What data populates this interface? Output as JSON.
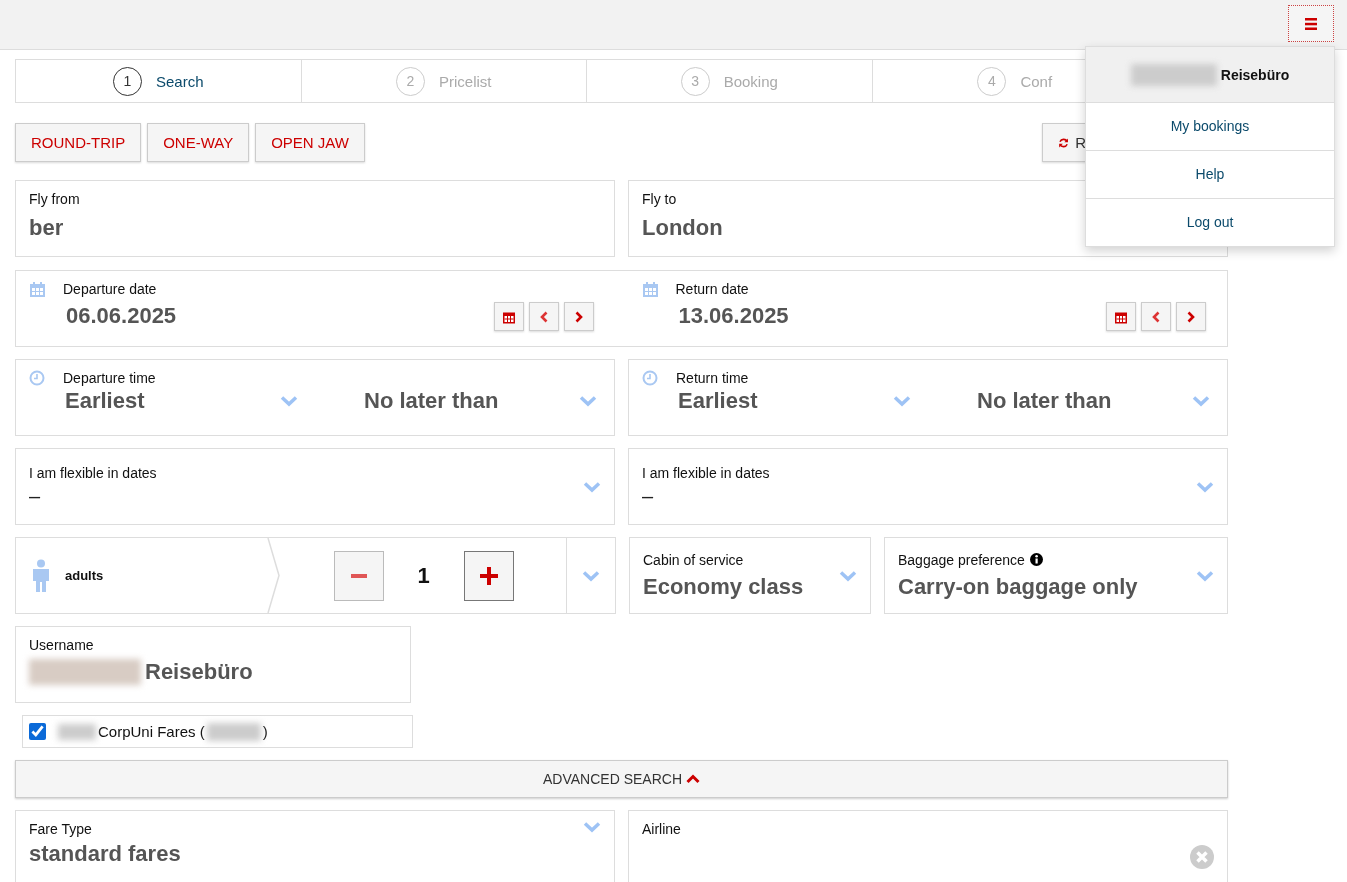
{
  "user_menu": {
    "name": "Reisebüro",
    "items": [
      "My bookings",
      "Help",
      "Log out"
    ]
  },
  "steps": [
    {
      "number": "1",
      "label": "Search",
      "selected": true
    },
    {
      "number": "2",
      "label": "Pricelist",
      "selected": false
    },
    {
      "number": "3",
      "label": "Booking",
      "selected": false
    },
    {
      "number": "4",
      "label": "Conf",
      "selected": false
    }
  ],
  "trip_types": [
    "ROUND-TRIP",
    "ONE-WAY",
    "OPEN JAW"
  ],
  "reset_button": {
    "label": "R"
  },
  "route": [
    {
      "label": "Fly from",
      "value": "ber"
    },
    {
      "label": "Fly to",
      "value": "London"
    }
  ],
  "dates": [
    {
      "label": "Departure date",
      "value": "06.06.2025"
    },
    {
      "label": "Return date",
      "value": "13.06.2025"
    }
  ],
  "times": [
    {
      "label": "Departure time",
      "from": "Earliest",
      "to": "No later than"
    },
    {
      "label": "Return time",
      "from": "Earliest",
      "to": "No later than"
    }
  ],
  "flexible": [
    {
      "label": "I am flexible in dates",
      "value": "–"
    },
    {
      "label": "I am flexible in dates",
      "value": "–"
    }
  ],
  "passengers": {
    "label": "adults",
    "count": "1"
  },
  "cabin": {
    "label": "Cabin of service",
    "value": "Economy class"
  },
  "baggage": {
    "label": "Baggage preference",
    "value": "Carry-on baggage only"
  },
  "username": {
    "label": "Username",
    "value": "Reisebüro"
  },
  "corp_fares": {
    "label": "CorpUni Fares (",
    "suffix": ")",
    "checked": true
  },
  "advanced_search": {
    "label": "ADVANCED SEARCH",
    "expanded": true
  },
  "fare_type": {
    "label": "Fare Type",
    "value": "standard fares"
  },
  "airline": {
    "label": "Airline"
  }
}
